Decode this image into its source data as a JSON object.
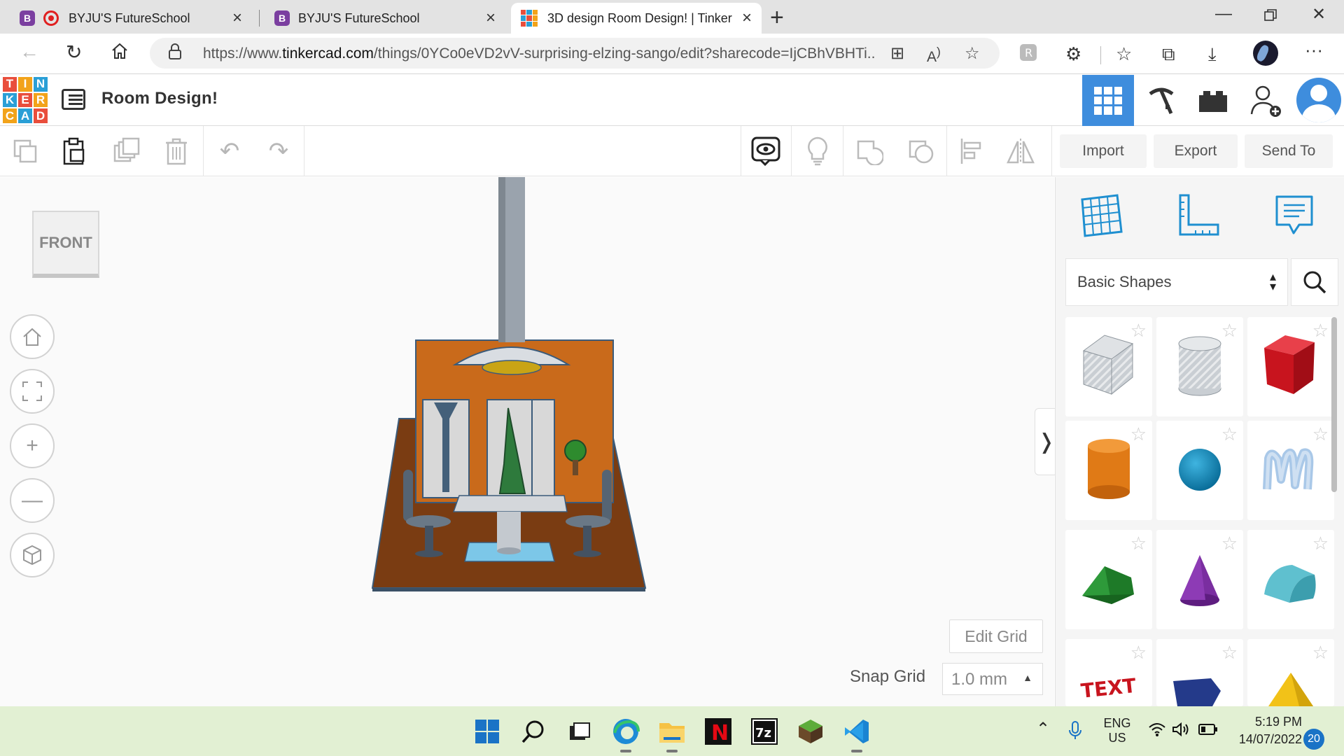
{
  "browser": {
    "tabs": [
      {
        "title": "BYJU'S FutureSchool",
        "favicon": "byjus-icon",
        "recording": true
      },
      {
        "title": "BYJU'S FutureSchool",
        "favicon": "byjus-icon",
        "recording": false
      },
      {
        "title": "3D design Room Design! | Tinker",
        "favicon": "tinkercad-icon",
        "active": true
      }
    ],
    "url_prefix": "https://www.",
    "url_host": "tinkercad.com",
    "url_path": "/things/0YCo0eVD2vV-surprising-elzing-sango/edit?sharecode=IjCBhVBHTi..."
  },
  "app": {
    "logo_letters": [
      "T",
      "I",
      "N",
      "K",
      "E",
      "R",
      "C",
      "A",
      "D"
    ],
    "design_title": "Room Design!",
    "colors": {
      "accent": "#3e8ddd",
      "logo_red": "#e94e3c",
      "logo_blue": "#2a9fd6",
      "logo_orange": "#f2a31a"
    }
  },
  "toolbar": {
    "import_label": "Import",
    "export_label": "Export",
    "sendto_label": "Send To"
  },
  "workplane": {
    "viewcube_label": "FRONT",
    "edit_grid_label": "Edit Grid",
    "snap_grid_label": "Snap Grid",
    "snap_grid_value": "1.0 mm"
  },
  "panel": {
    "category": "Basic Shapes",
    "shapes": [
      "Box (hole)",
      "Cylinder (hole)",
      "Box",
      "Cylinder",
      "Sphere",
      "Scribble",
      "Roof",
      "Cone",
      "Round Roof",
      "Text",
      "Polygon",
      "Pyramid"
    ]
  },
  "taskbar": {
    "lang_line1": "ENG",
    "lang_line2": "US",
    "time": "5:19 PM",
    "date": "14/07/2022",
    "notifications": "20"
  }
}
